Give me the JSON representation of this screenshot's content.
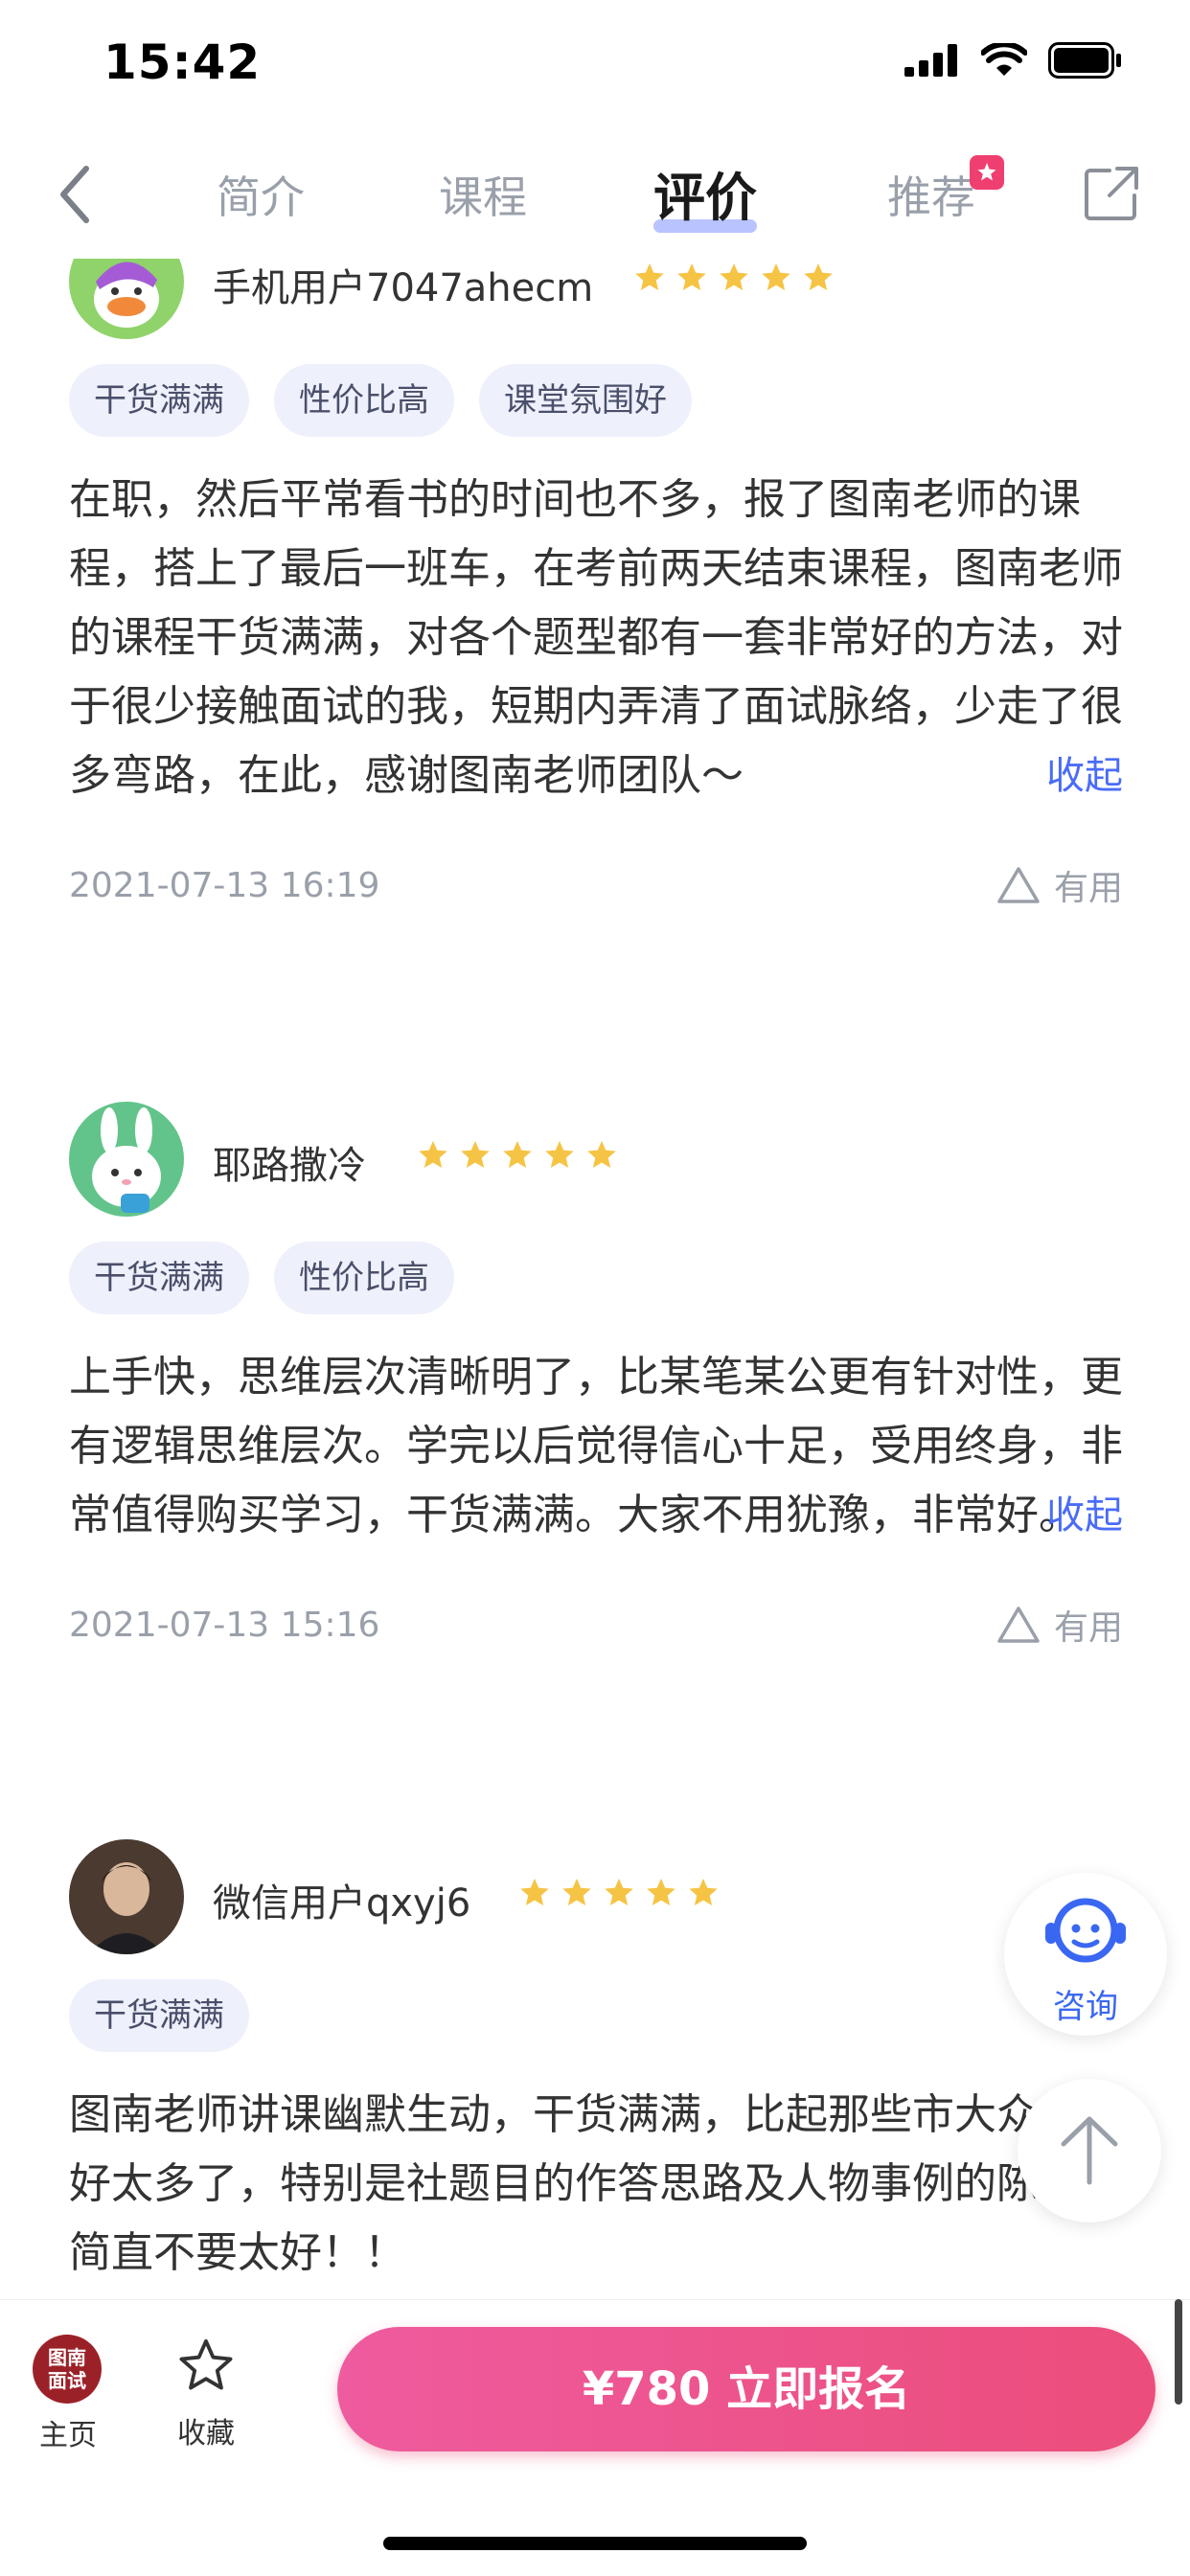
{
  "status": {
    "time": "15:42"
  },
  "nav": {
    "tabs": [
      "简介",
      "课程",
      "评价",
      "推荐"
    ],
    "active_tab": "评价"
  },
  "reviews": [
    {
      "username": "手机用户7047ahecm",
      "rating": 5,
      "tags": [
        "干货满满",
        "性价比高",
        "课堂氛围好"
      ],
      "text": "在职，然后平常看书的时间也不多，报了图南老师的课程，搭上了最后一班车，在考前两天结束课程，图南老师的课程干货满满，对各个题型都有一套非常好的方法，对于很少接触面试的我，短期内弄清了面试脉络，少走了很多弯路，在此，感谢图南老师团队～",
      "collapse_label": "收起",
      "date": "2021-07-13 16:19",
      "useful_label": "有用"
    },
    {
      "username": "耶路撒冷",
      "rating": 5,
      "tags": [
        "干货满满",
        "性价比高"
      ],
      "text": "上手快，思维层次清晰明了，比某笔某公更有针对性，更有逻辑思维层次。学完以后觉得信心十足，受用终身，非常值得购买学习，干货满满。大家不用犹豫，非常好。",
      "collapse_label": "收起",
      "date": "2021-07-13 15:16",
      "useful_label": "有用"
    },
    {
      "username": "微信用户qxyj6",
      "rating": 5,
      "tags": [
        "干货满满"
      ],
      "text": "图南老师讲课幽默生动，干货满满，比起那些市大众机构好太多了，特别是社题目的作答思路及人物事例的陈述，简直不要太好！！"
    }
  ],
  "float": {
    "consult_label": "咨询"
  },
  "bottom": {
    "logo_text_1": "图南",
    "logo_text_2": "面试",
    "home_label": "主页",
    "favorite_label": "收藏",
    "enroll_label": "¥780 立即报名"
  },
  "colors": {
    "accent": "#4a6cf7",
    "star": "#f6c445",
    "enroll_start": "#ee5b9e",
    "enroll_end": "#ec4d7b",
    "tag_bg": "#eef0fb"
  }
}
